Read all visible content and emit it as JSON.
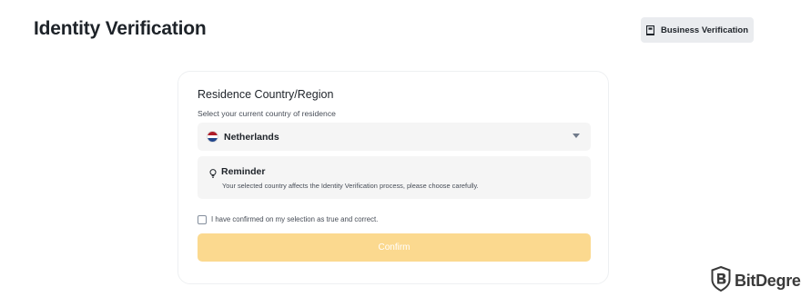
{
  "header": {
    "title": "Identity Verification",
    "business_button_label": "Business Verification",
    "business_button_icon": "building-icon"
  },
  "card": {
    "title": "Residence Country/Region",
    "subtitle": "Select your current country of residence",
    "country_select": {
      "value": "Netherlands",
      "flag_icon": "netherlands-flag-icon",
      "flag_colors": [
        "#ae1c28",
        "#ffffff",
        "#21468b"
      ]
    },
    "reminder": {
      "icon": "lightbulb-icon",
      "title": "Reminder",
      "text": "Your selected country affects the Identity Verification process, please choose carefully."
    },
    "confirm_checkbox": {
      "checked": false,
      "label": "I have confirmed on my selection as true and correct."
    },
    "confirm_button": {
      "label": "Confirm",
      "enabled": false
    }
  },
  "watermark": {
    "text": "BitDegree",
    "logo_icon": "bitdegree-shield-logo"
  },
  "colors": {
    "accent_disabled": "#fbd98f",
    "panel_bg": "#f5f5f5",
    "text_primary": "#1e2329"
  }
}
